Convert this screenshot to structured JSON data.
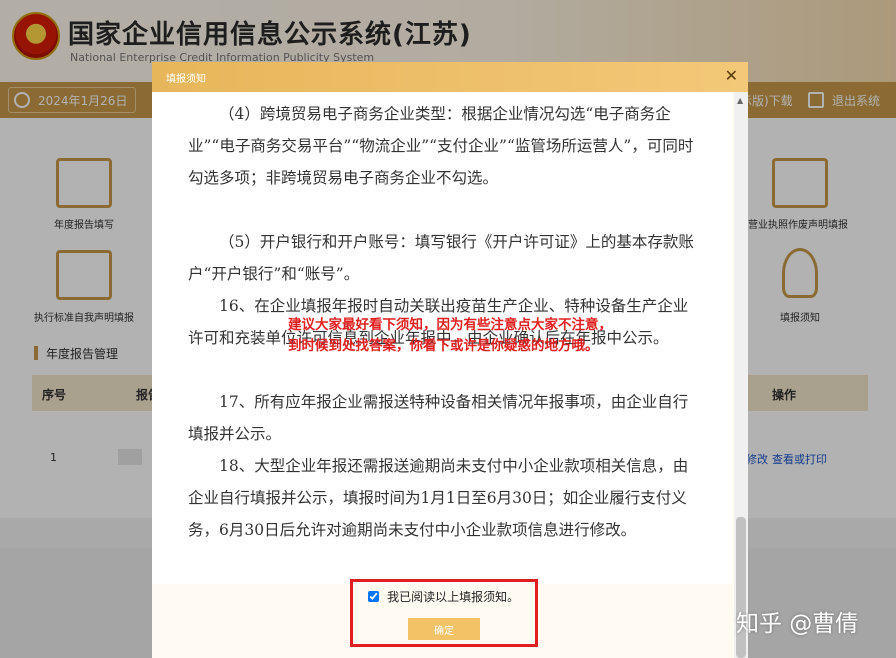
{
  "site": {
    "title": "国家企业信用信息公示系统(江苏)",
    "subtitle": "National Enterprise Credit Information Publicity System"
  },
  "navbar": {
    "date": "2024年1月26日",
    "download_label": "示版)下载",
    "logout_label": "退出系统"
  },
  "tiles": [
    {
      "label": "年度报告填写",
      "icon": "pencil-edit-icon"
    },
    {
      "label": "执行标准自我声明填报",
      "icon": "inbox-tray-icon"
    },
    {
      "label": "营业执照作废声明填报",
      "icon": "document-list-icon"
    },
    {
      "label": "填报须知",
      "icon": "lightbulb-icon"
    }
  ],
  "section": {
    "title": "年度报告管理"
  },
  "table": {
    "headers": [
      "序号",
      "报告",
      "操作"
    ],
    "row": {
      "index": "1",
      "actions": [
        "修改",
        "查看或打印"
      ]
    }
  },
  "modal": {
    "title": "填报须知",
    "paragraphs": [
      "（4）跨境贸易电子商务企业类型：根据企业情况勾选“电子商务企业”“电子商务交易平台”“物流企业”“支付企业”“监管场所运营人”，可同时勾选多项；非跨境贸易电子商务企业不勾选。",
      "（5）开户银行和开户账号：填写银行《开户许可证》上的基本存款账户“开户银行”和“账号”。",
      "16、在企业填报年报时自动关联出疫苗生产企业、特种设备生产企业许可和充装单位许可信息到企业年报中，由企业确认后在年报中公示。",
      "17、所有应年报企业需报送特种设备相关情况年报事项，由企业自行填报并公示。",
      "18、大型企业年报还需报送逾期尚未支付中小企业款项相关信息，由企业自行填报并公示，填报时间为1月1日至6月30日；如企业履行支付义务，6月30日后允许对逾期尚未支付中小企业款项信息进行修改。"
    ],
    "agree_label": "我已阅读以上填报须知。",
    "confirm_label": "确定"
  },
  "annotation": {
    "line1": "建议大家最好看下须知，因为有些注意点大家不注意，",
    "line2": "到时候到处找答案，你看下或许是你疑惑的地方哦。"
  },
  "watermark": "知乎 @曹倩",
  "colors": {
    "brand_gold": "#c79a4a",
    "header_gold": "#e7b65a",
    "highlight_red": "#e02020",
    "button": "#f3c166"
  }
}
